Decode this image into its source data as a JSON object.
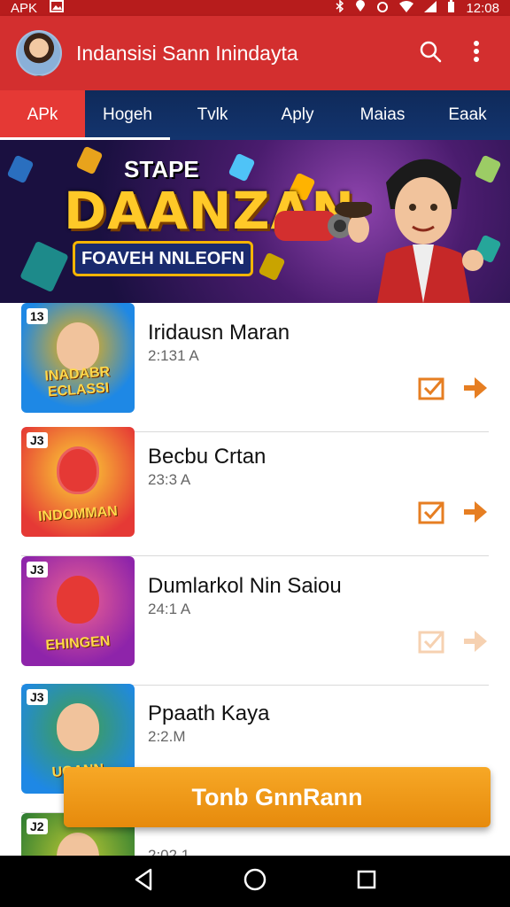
{
  "status_bar": {
    "label": "APK",
    "time": "12:08"
  },
  "app_bar": {
    "title": "Indansisi Sann Inindayta"
  },
  "tabs": [
    {
      "label": "APk"
    },
    {
      "label": "Hogeh"
    },
    {
      "label": "Tvlk"
    },
    {
      "label": "Aply"
    },
    {
      "label": "Maias"
    },
    {
      "label": "Eaak"
    }
  ],
  "banner": {
    "small_title": "STAPE",
    "big_title": "DAANZAN",
    "subtitle": "FOAVEH NNLEOFN"
  },
  "apps": [
    {
      "number": "13",
      "name": "Iridausn Maran",
      "size": "2:131 A",
      "caption": "INADABR ECLASSI",
      "colors": [
        "#1e88e5",
        "#ffb300"
      ]
    },
    {
      "number": "J3",
      "name": "Becbu Crtan",
      "size": "23:3 A",
      "caption": "INDOMMAN",
      "colors": [
        "#fdd835",
        "#e53935"
      ]
    },
    {
      "number": "J3",
      "name": "Dumlarkol Nin Saiou",
      "size": "24:1 A",
      "caption": "EHINGEN",
      "colors": [
        "#8e24aa",
        "#f06292"
      ]
    },
    {
      "number": "J3",
      "name": "Ppaath Kaya",
      "size": "2:2.M",
      "caption": "UGANN",
      "colors": [
        "#43a047",
        "#1e88e5"
      ]
    },
    {
      "number": "J2",
      "name": "",
      "size": "2:02.1",
      "caption": "",
      "colors": [
        "#2e7d32",
        "#c0ca33"
      ]
    }
  ],
  "primary_button": {
    "label": "Tonb GnnRann"
  },
  "colors": {
    "app_bar": "#d32f2f",
    "tab_bar": "#13346e",
    "accent": "#f39c12"
  }
}
